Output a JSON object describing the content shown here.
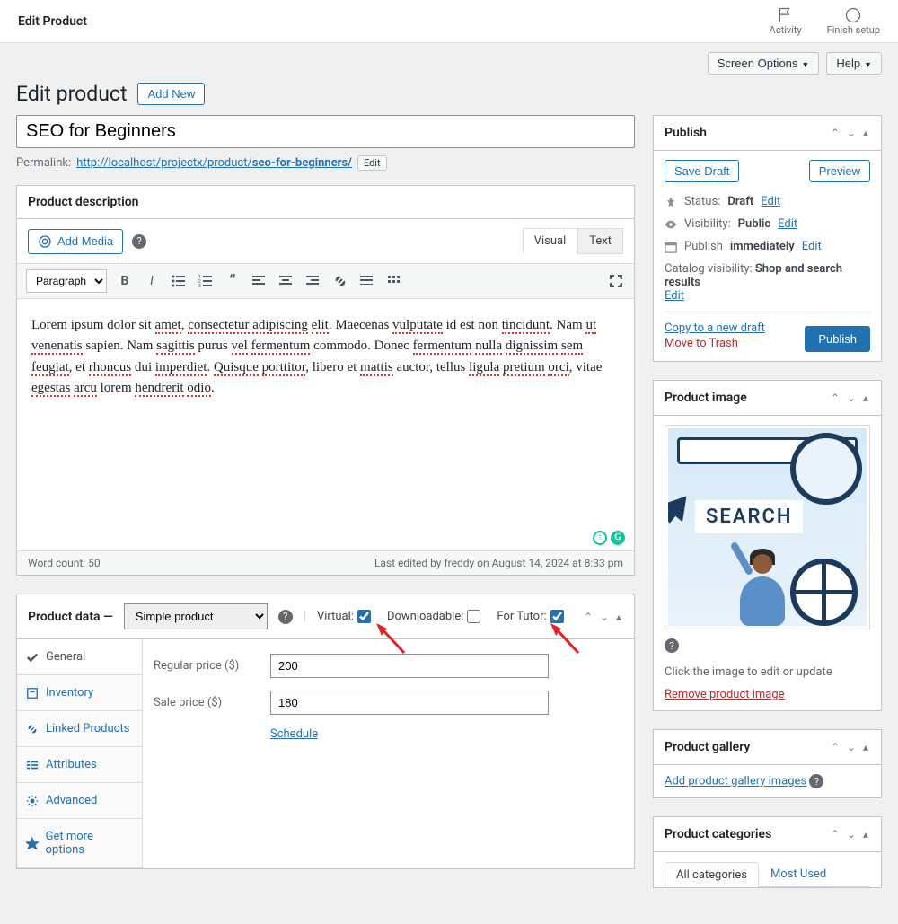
{
  "topbar": {
    "title": "Edit Product",
    "activity": "Activity",
    "finish": "Finish setup"
  },
  "header_btns": {
    "screen_options": "Screen Options",
    "help": "Help"
  },
  "page": {
    "heading": "Edit product",
    "add_new": "Add New"
  },
  "title_input": "SEO for Beginners",
  "permalink": {
    "label": "Permalink:",
    "base": "http://localhost/projectx/product/",
    "slug": "seo-for-beginners/",
    "edit": "Edit"
  },
  "desc_box": {
    "title": "Product description",
    "add_media": "Add Media",
    "tabs": {
      "visual": "Visual",
      "text": "Text"
    },
    "format_sel": "Paragraph",
    "content_words": [
      "Lorem",
      "ipsum",
      "dolor",
      "sit",
      "amet",
      ",",
      "consectetur",
      "adipiscing",
      "elit",
      ".",
      "Maecenas",
      "vulputate",
      "id",
      "est",
      "non",
      "tincidunt",
      ".",
      "Nam",
      "ut",
      "venenatis",
      "sapien",
      ".",
      "Nam",
      "sagittis",
      "purus",
      "vel",
      "fermentum",
      "commodo",
      ".",
      "Donec",
      "fermentum",
      "nulla",
      "dignissim",
      "sem",
      "feugiat",
      ",",
      "et",
      "rhoncus",
      "dui",
      "imperdiet",
      ".",
      "Quisque",
      "porttitor",
      ",",
      "libero",
      "et",
      "mattis",
      "auctor",
      ",",
      "tellus",
      "ligula",
      "pretium",
      "orci",
      ",",
      "vitae",
      "egestas",
      "arcu",
      "lorem",
      "hendrerit",
      "odio",
      "."
    ],
    "spell_err": [
      "amet",
      "consectetur",
      "adipiscing",
      "elit",
      "vulputate",
      "tincidunt",
      "ut",
      "venenatis",
      "sagittis",
      "vel",
      "fermentum",
      "nulla",
      "dignissim",
      "sem",
      "feugiat",
      "rhoncus",
      "imperdiet",
      "Quisque",
      "porttitor",
      "mattis",
      "ligula",
      "pretium",
      "orci",
      "egestas",
      "arcu",
      "hendrerit",
      "odio"
    ],
    "word_count": "Word count: 50",
    "last_edited": "Last edited by freddy on August 14, 2024 at 8:33 pm"
  },
  "product_data": {
    "title": "Product data",
    "type": "Simple product",
    "checks": {
      "virtual": "Virtual:",
      "downloadable": "Downloadable:",
      "tutor": "For Tutor:"
    },
    "tabs": [
      "General",
      "Inventory",
      "Linked Products",
      "Attributes",
      "Advanced",
      "Get more options"
    ],
    "regular_label": "Regular price ($)",
    "regular_val": "200",
    "sale_label": "Sale price ($)",
    "sale_val": "180",
    "schedule": "Schedule"
  },
  "publish": {
    "title": "Publish",
    "save_draft": "Save Draft",
    "preview": "Preview",
    "status_lbl": "Status:",
    "status_val": "Draft",
    "vis_lbl": "Visibility:",
    "vis_val": "Public",
    "pub_lbl": "Publish",
    "pub_val": "immediately",
    "cat_lbl": "Catalog visibility:",
    "cat_val": "Shop and search results",
    "edit": "Edit",
    "copy": "Copy to a new draft",
    "trash": "Move to Trash",
    "publish_btn": "Publish"
  },
  "img_box": {
    "title": "Product image",
    "search_text": "SEARCH",
    "click_hint": "Click the image to edit or update",
    "remove": "Remove product image"
  },
  "gallery": {
    "title": "Product gallery",
    "add": "Add product gallery images"
  },
  "cats": {
    "title": "Product categories",
    "all": "All categories",
    "most": "Most Used"
  }
}
